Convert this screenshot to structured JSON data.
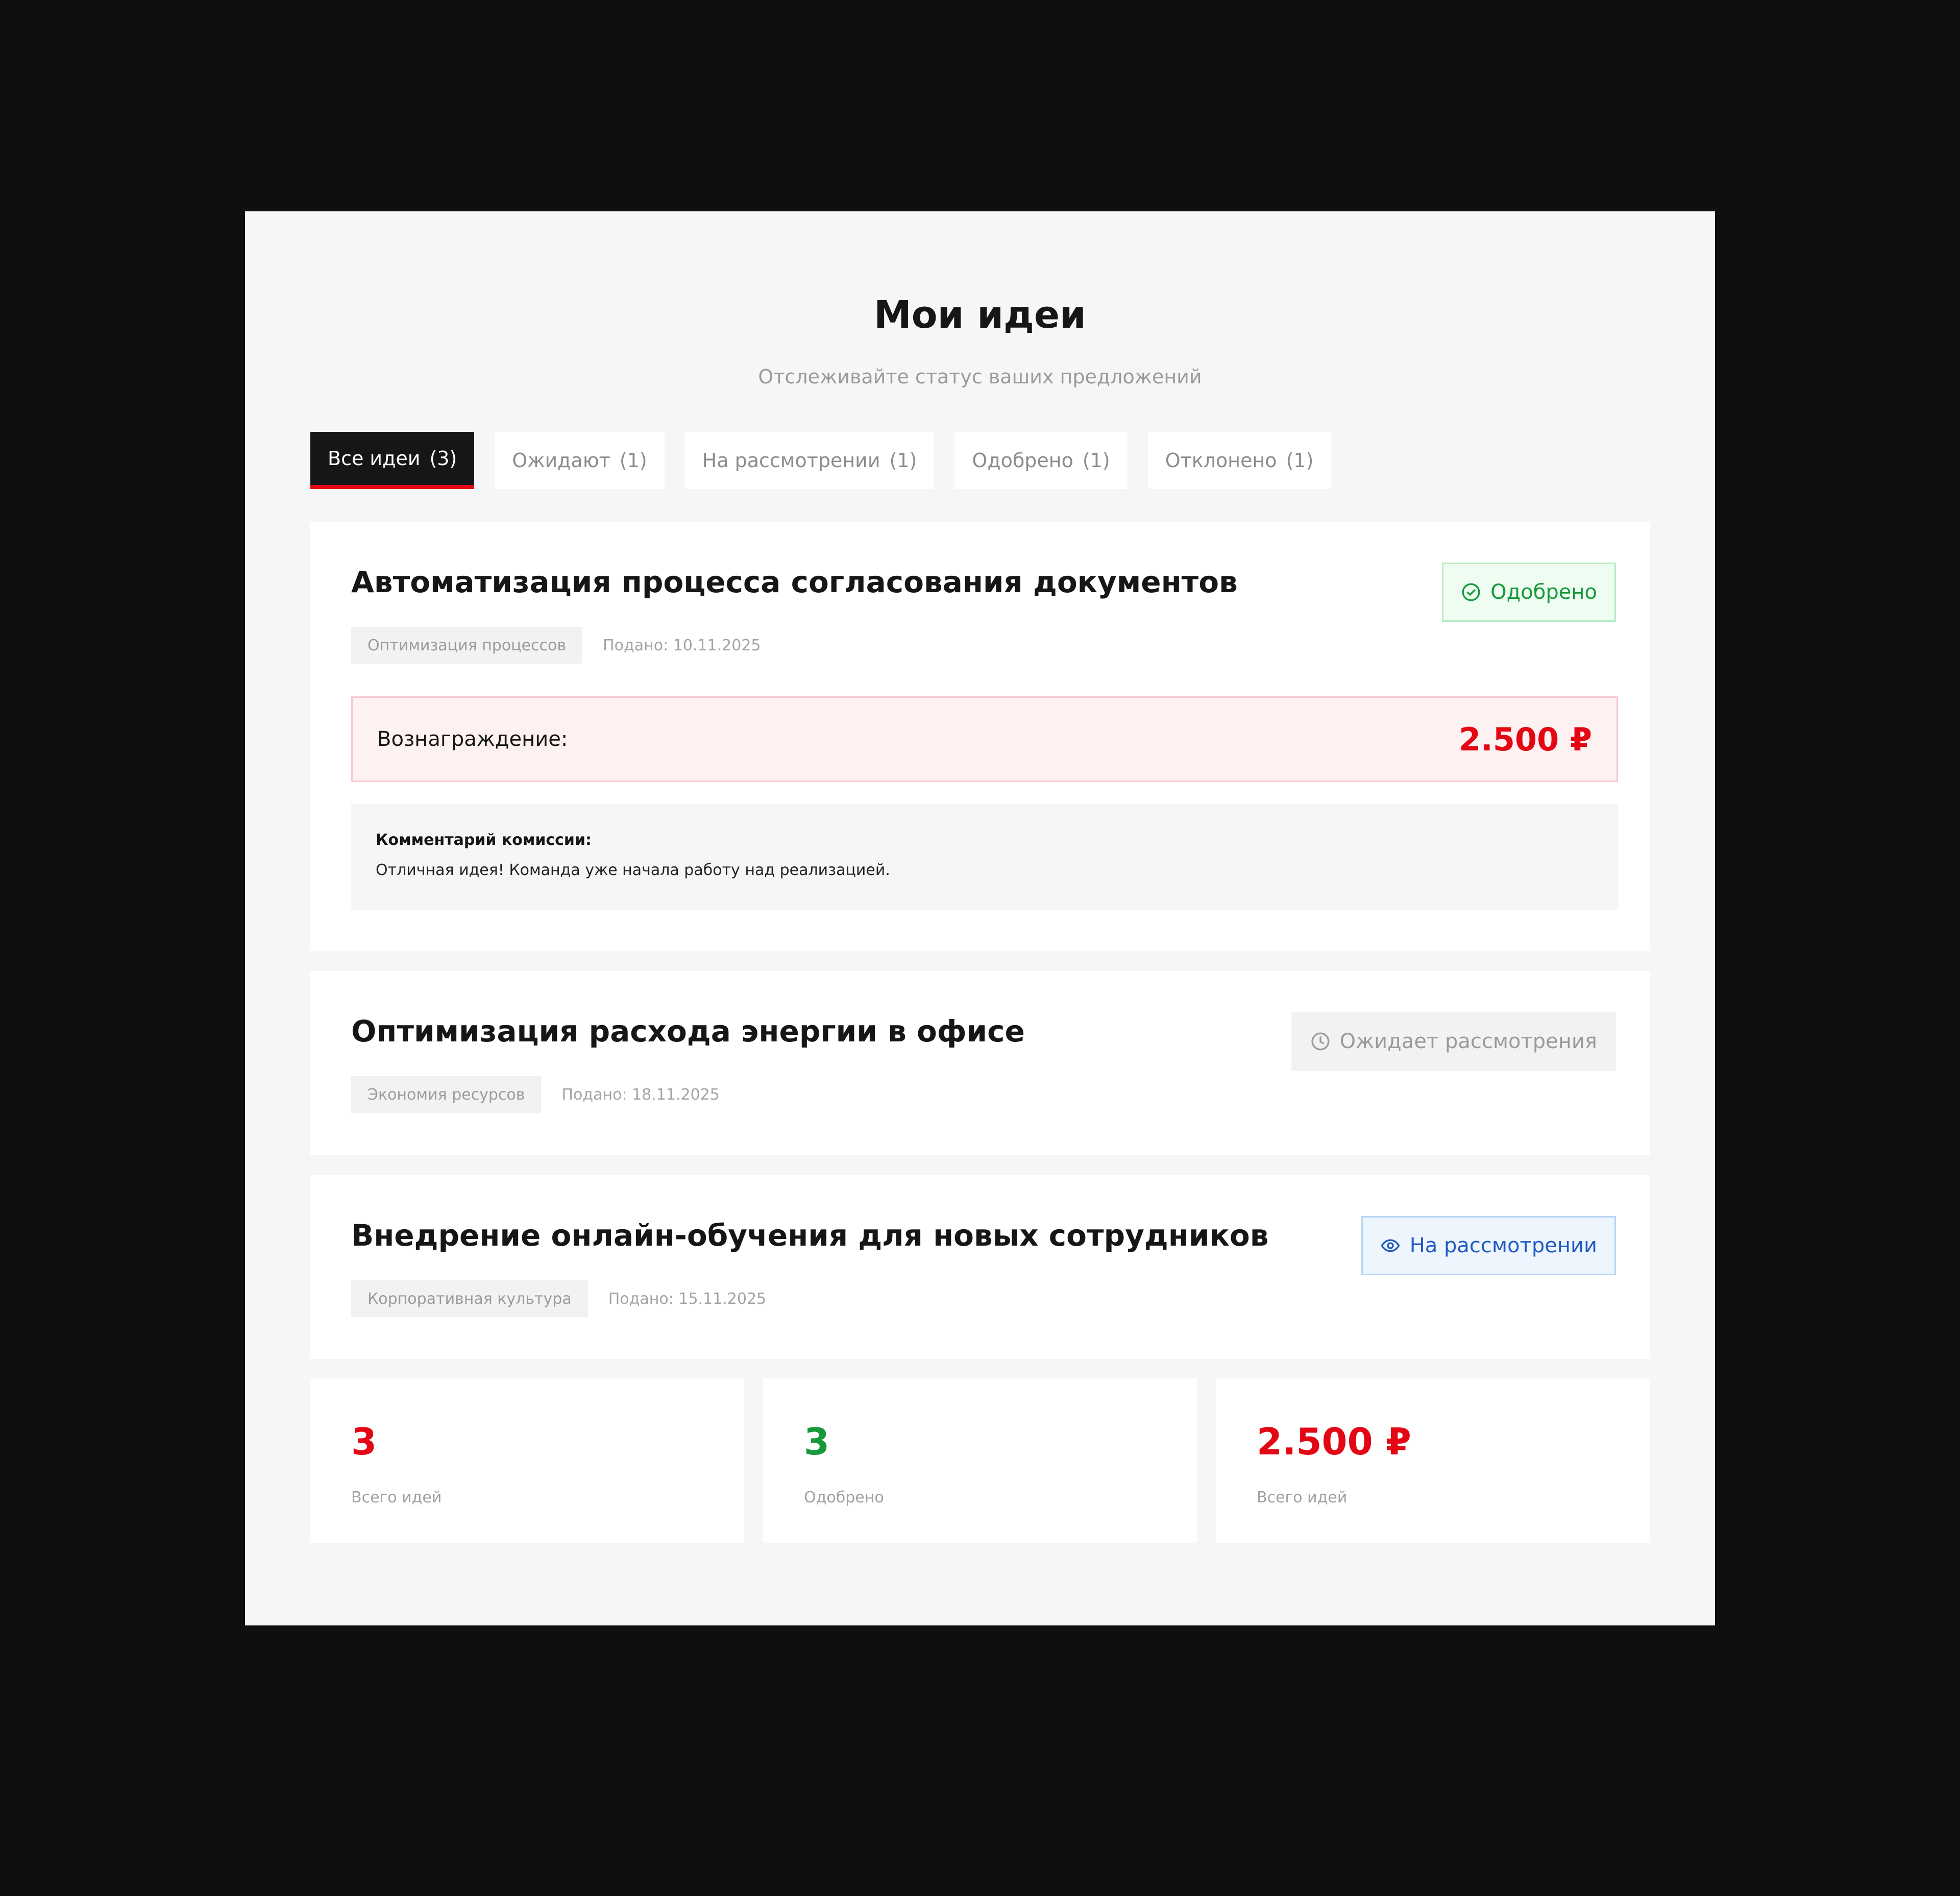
{
  "header": {
    "title": "Мои идеи",
    "subtitle": "Отслеживайте статус ваших предложений"
  },
  "tabs": [
    {
      "label": "Все идеи",
      "count": "(3)",
      "active": true
    },
    {
      "label": "Ожидают",
      "count": "(1)"
    },
    {
      "label": "На рассмотрении",
      "count": "(1)"
    },
    {
      "label": "Одобрено",
      "count": "(1)"
    },
    {
      "label": "Отклонено",
      "count": "(1)"
    }
  ],
  "ideas": [
    {
      "title": "Автоматизация процесса согласования документов",
      "category": "Оптимизация процессов",
      "submitted": "Подано: 10.11.2025",
      "status": "Одобрено",
      "status_icon": "check-circle-icon",
      "reward_label": "Вознаграждение:",
      "reward_value": "2.500 ₽",
      "comment_label": "Комментарий комиссии:",
      "comment_text": "Отличная идея! Команда уже начала работу над реализацией."
    },
    {
      "title": "Оптимизация расхода энергии в офисе",
      "category": "Экономия ресурсов",
      "submitted": "Подано: 18.11.2025",
      "status": "Ожидает рассмотрения",
      "status_icon": "clock-icon"
    },
    {
      "title": "Внедрение онлайн-обучения для новых сотрудников",
      "category": "Корпоративная культура",
      "submitted": "Подано: 15.11.2025",
      "status": "На рассмотрении",
      "status_icon": "eye-icon"
    }
  ],
  "stats": [
    {
      "value": "3",
      "label": "Всего идей",
      "color": "#e30613"
    },
    {
      "value": "3",
      "label": "Одобрено",
      "color": "#17993b"
    },
    {
      "value": "2.500 ₽",
      "label": "Всего идей",
      "color": "#e30613"
    }
  ],
  "colors": {
    "accent": "#e30613",
    "approved": "#17993b",
    "review": "#1f5bbf",
    "pending": "#9a9a9a"
  }
}
